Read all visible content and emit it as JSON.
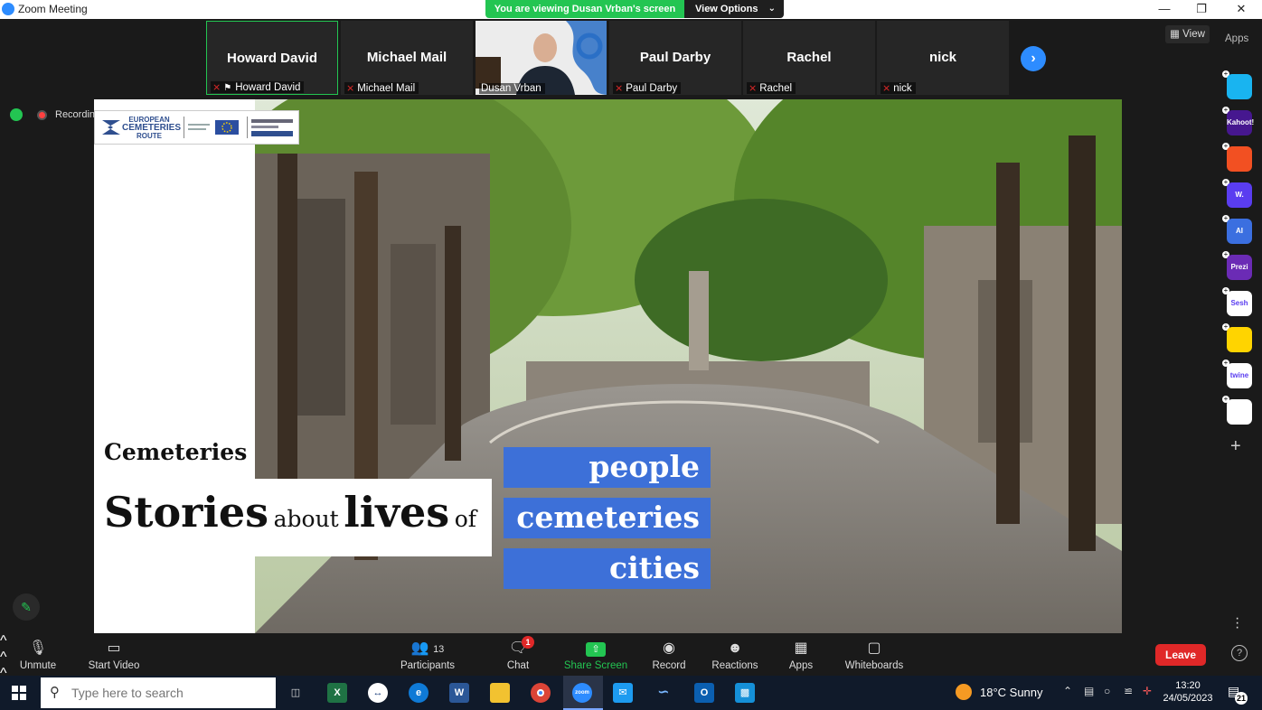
{
  "window": {
    "title": "Zoom Meeting",
    "minimize_icon": "minimize-icon",
    "maximize_icon": "restore-icon",
    "close_icon": "close-icon"
  },
  "share_banner": {
    "text": "You are viewing Dusan Vrban's screen",
    "view_options": "View Options"
  },
  "participants_strip": [
    {
      "display": "Howard David",
      "label": "Howard David",
      "muted": true,
      "pinned": true,
      "active": true
    },
    {
      "display": "Michael Mail",
      "label": "Michael Mail",
      "muted": true
    },
    {
      "display": "",
      "label": "Dusan Vrban",
      "muted": false,
      "video": true
    },
    {
      "display": "Paul Darby",
      "label": "Paul Darby",
      "muted": true
    },
    {
      "display": "Rachel",
      "label": "Rachel",
      "muted": true
    },
    {
      "display": "nick",
      "label": "nick",
      "muted": true
    }
  ],
  "top_right": {
    "view_label": "View",
    "apps_label": "Apps"
  },
  "recording": {
    "label": "Recording"
  },
  "slide": {
    "logo_text_1": "EUROPEAN",
    "logo_text_2": "CEMETERIES",
    "logo_text_3": "ROUTE",
    "heading": "Cemeteries",
    "line_word_1": "Stories",
    "line_word_2": "about",
    "line_word_3": "lives",
    "line_word_4": "of",
    "boxes": [
      "people",
      "cemeteries",
      "cities"
    ]
  },
  "side_apps": [
    {
      "name": "pitch-app-icon",
      "text": "",
      "color": "#19b4f0"
    },
    {
      "name": "kahoot-app-icon",
      "text": "Kahoot!",
      "color": "#46178f"
    },
    {
      "name": "app-red-icon",
      "text": "",
      "color": "#f25022"
    },
    {
      "name": "wooclap-app-icon",
      "text": "W.",
      "color": "#5a3df0"
    },
    {
      "name": "ai-app-icon",
      "text": "AI",
      "color": "#3b6fe0"
    },
    {
      "name": "prezi-app-icon",
      "text": "Prezi",
      "color": "#6b2bb5"
    },
    {
      "name": "sesh-app-icon",
      "text": "Sesh",
      "color": "#ffffff"
    },
    {
      "name": "emoji-app-icon",
      "text": "",
      "color": "#ffd400"
    },
    {
      "name": "twine-app-icon",
      "text": "twine",
      "color": "#ffffff"
    },
    {
      "name": "grid-app-icon",
      "text": "",
      "color": "#ffffff"
    }
  ],
  "controls": {
    "unmute": "Unmute",
    "start_video": "Start Video",
    "participants": "Participants",
    "participants_count": "13",
    "chat": "Chat",
    "chat_badge": "1",
    "share_screen": "Share Screen",
    "record": "Record",
    "reactions": "Reactions",
    "apps": "Apps",
    "whiteboards": "Whiteboards",
    "leave": "Leave",
    "help": "?"
  },
  "taskbar": {
    "search_placeholder": "Type here to search",
    "weather": "18°C  Sunny",
    "time": "13:20",
    "date": "24/05/2023",
    "notifications": "21"
  }
}
